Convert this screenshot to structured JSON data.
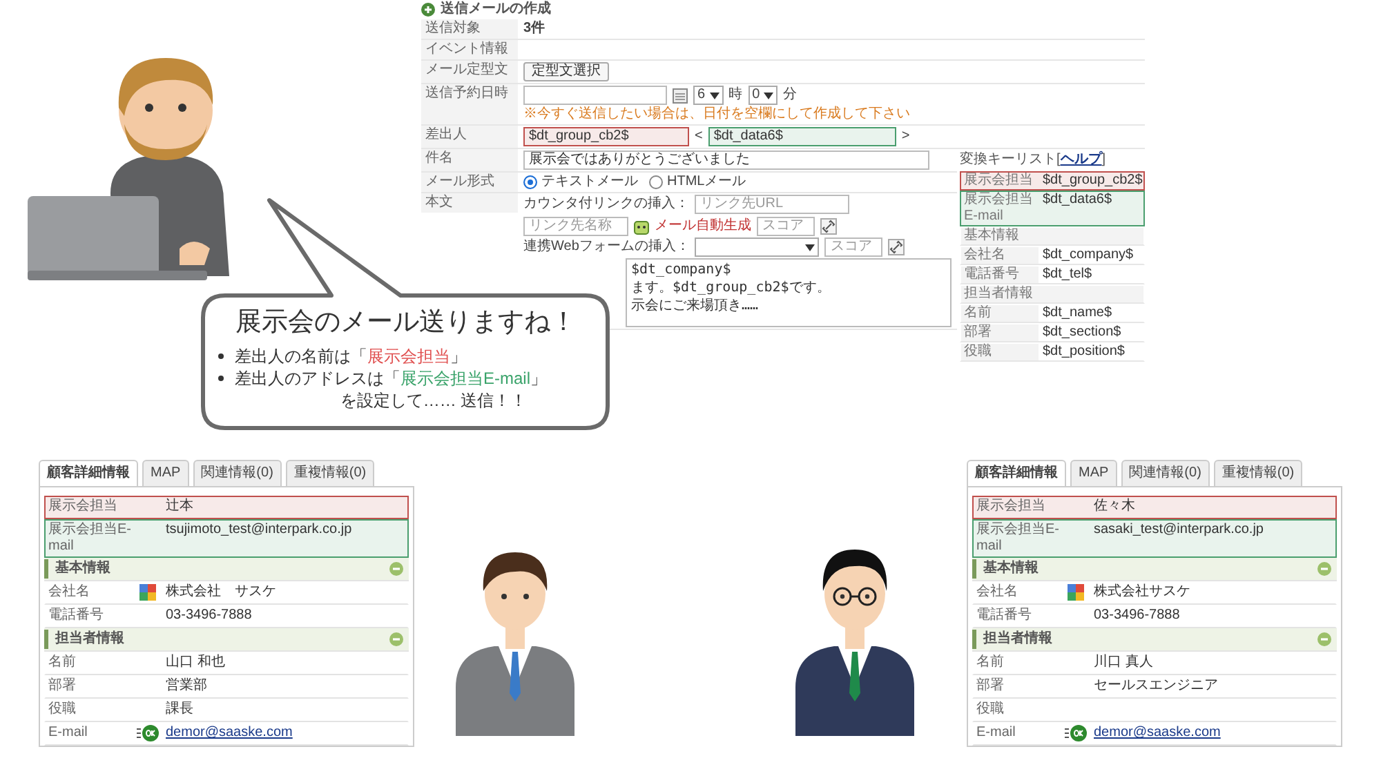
{
  "mail_form": {
    "title": "送信メールの作成",
    "target": {
      "label": "送信対象",
      "value": "3件"
    },
    "event": {
      "label": "イベント情報"
    },
    "template": {
      "label": "メール定型文",
      "button": "定型文選択"
    },
    "schedule": {
      "label": "送信予約日時",
      "hour": "6",
      "hour_unit": "時",
      "minute": "0",
      "minute_unit": "分",
      "note": "※今すぐ送信したい場合は、日付を空欄にして作成して下さい"
    },
    "sender": {
      "label": "差出人",
      "lt": "<",
      "gt": ">",
      "fields": [
        {
          "value": "$dt_group_cb2$",
          "color": "#c0504d"
        },
        {
          "value": "$dt_data6$",
          "color": "#4a9e6e"
        }
      ]
    },
    "subject": {
      "label": "件名",
      "value": "展示会ではありがとうございました"
    },
    "format": {
      "label": "メール形式",
      "options": [
        {
          "label": "テキストメール",
          "selected": true
        },
        {
          "label": "HTMLメール",
          "selected": false
        }
      ]
    },
    "body": {
      "label": "本文",
      "link_label": "カウンタ付リンクの挿入：",
      "url_placeholder": "リンク先URL",
      "name_placeholder": "リンク先名称",
      "auto_label": "メール自動生成",
      "score_placeholder": "スコア",
      "form_label": "連携Webフォームの挿入：",
      "form_score_placeholder": "スコア",
      "lines": [
        "$dt_company$",
        "ます。$dt_group_cb2$です。",
        "示会にご来場頂き……"
      ]
    },
    "key_list": {
      "title": "変換キーリスト[",
      "help": "ヘルプ",
      "close": "]",
      "rows": [
        {
          "kind": "key",
          "label": "展示会担当",
          "value": "$dt_group_cb2$",
          "color": "#c0504d"
        },
        {
          "kind": "key",
          "label": "展示会担当E-mail",
          "value": "$dt_data6$",
          "color": "#4a9e6e"
        },
        {
          "kind": "header",
          "label": "基本情報"
        },
        {
          "kind": "key",
          "label": "会社名",
          "value": "$dt_company$"
        },
        {
          "kind": "key",
          "label": "電話番号",
          "value": "$dt_tel$"
        },
        {
          "kind": "header",
          "label": "担当者情報"
        },
        {
          "kind": "key",
          "label": "名前",
          "value": "$dt_name$"
        },
        {
          "kind": "key",
          "label": "部署",
          "value": "$dt_section$"
        },
        {
          "kind": "key",
          "label": "役職",
          "value": "$dt_position$"
        }
      ]
    }
  },
  "bubble": {
    "title": "展示会のメール送りますね！",
    "bullets": [
      {
        "before": "差出人の名前は「",
        "key": "展示会担当",
        "after": "」",
        "color": "#e05050"
      },
      {
        "before": "差出人のアドレスは「",
        "key": "展示会担当E-mail",
        "after": "」",
        "color": "#3aa36a"
      }
    ],
    "closing": "を設定して…… 送信！！"
  },
  "customers": [
    {
      "tabs": [
        {
          "label": "顧客詳細情報",
          "selected": true
        },
        {
          "label": "MAP",
          "selected": false
        },
        {
          "label": "関連情報(0)",
          "selected": false
        },
        {
          "label": "重複情報(0)",
          "selected": false
        }
      ],
      "rows": [
        {
          "kind": "field",
          "label": "展示会担当",
          "value": "辻本",
          "color": "#c0504d"
        },
        {
          "kind": "field",
          "label": "展示会担当E-mail",
          "value": "tsujimoto_test@interpark.co.jp",
          "color": "#4a9e6e"
        },
        {
          "kind": "section",
          "label": "基本情報"
        },
        {
          "kind": "company",
          "label": "会社名",
          "value": "株式会社　サスケ"
        },
        {
          "kind": "field",
          "label": "電話番号",
          "value": "03-3496-7888"
        },
        {
          "kind": "section",
          "label": "担当者情報"
        },
        {
          "kind": "field",
          "label": "名前",
          "value": "山口 和也"
        },
        {
          "kind": "field",
          "label": "部署",
          "value": "営業部"
        },
        {
          "kind": "field",
          "label": "役職",
          "value": "課長"
        },
        {
          "kind": "email",
          "label": "E-mail",
          "value": "demor@saaske.com"
        }
      ]
    },
    {
      "tabs": [
        {
          "label": "顧客詳細情報",
          "selected": true
        },
        {
          "label": "MAP",
          "selected": false
        },
        {
          "label": "関連情報(0)",
          "selected": false
        },
        {
          "label": "重複情報(0)",
          "selected": false
        }
      ],
      "rows": [
        {
          "kind": "field",
          "label": "展示会担当",
          "value": "佐々木",
          "color": "#c0504d"
        },
        {
          "kind": "field",
          "label": "展示会担当E-mail",
          "value": "sasaki_test@interpark.co.jp",
          "color": "#4a9e6e"
        },
        {
          "kind": "section",
          "label": "基本情報"
        },
        {
          "kind": "company",
          "label": "会社名",
          "value": "株式会社サスケ"
        },
        {
          "kind": "field",
          "label": "電話番号",
          "value": "03-3496-7888"
        },
        {
          "kind": "section",
          "label": "担当者情報"
        },
        {
          "kind": "field",
          "label": "名前",
          "value": "川口 真人"
        },
        {
          "kind": "field",
          "label": "部署",
          "value": "セールスエンジニア"
        },
        {
          "kind": "field",
          "label": "役職"
        },
        {
          "kind": "email",
          "label": "E-mail",
          "value": "demor@saaske.com"
        }
      ]
    }
  ]
}
